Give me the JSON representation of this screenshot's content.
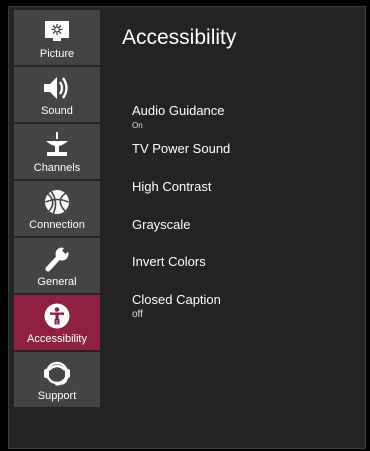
{
  "sidebar": {
    "items": [
      {
        "label": "Picture",
        "icon": "picture-icon"
      },
      {
        "label": "Sound",
        "icon": "speaker-icon"
      },
      {
        "label": "Channels",
        "icon": "antenna-icon"
      },
      {
        "label": "Connection",
        "icon": "globe-icon"
      },
      {
        "label": "General",
        "icon": "wrench-icon"
      },
      {
        "label": "Accessibility",
        "icon": "accessibility-icon",
        "active": true
      },
      {
        "label": "Support",
        "icon": "headset-icon"
      }
    ]
  },
  "main": {
    "title": "Accessibility",
    "items": [
      {
        "label": "Audio Guidance",
        "value": "On"
      },
      {
        "label": "TV Power Sound"
      },
      {
        "label": "High Contrast"
      },
      {
        "label": "Grayscale"
      },
      {
        "label": "Invert Colors"
      },
      {
        "label": "Closed Caption",
        "value": "off"
      }
    ]
  },
  "colors": {
    "active": "#8e2141",
    "sidebar_item": "#444444",
    "panel": "#232323"
  }
}
